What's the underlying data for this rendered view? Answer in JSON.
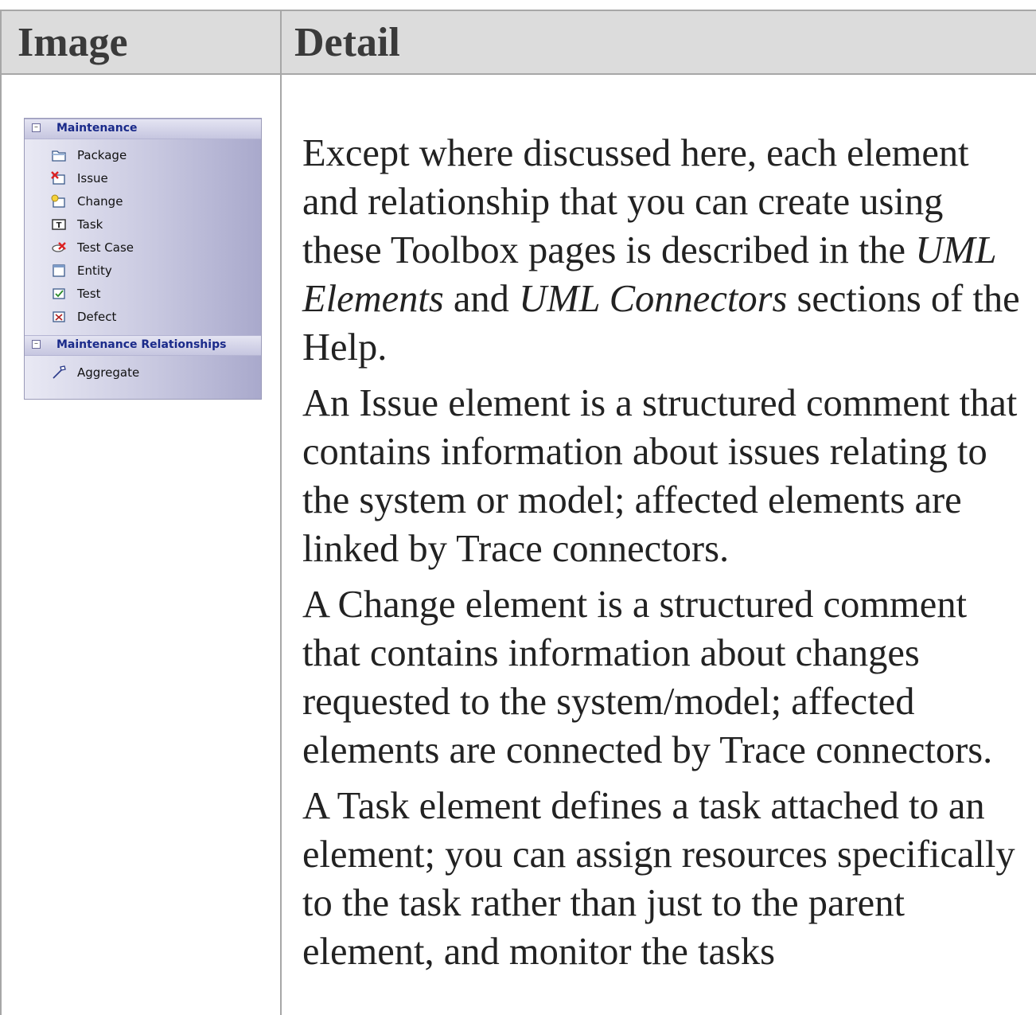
{
  "table": {
    "headers": [
      "Image",
      "Detail"
    ]
  },
  "toolbox": {
    "sections": [
      {
        "title": "Maintenance",
        "items": [
          {
            "label": "Package",
            "icon": "package-icon"
          },
          {
            "label": "Issue",
            "icon": "issue-icon"
          },
          {
            "label": "Change",
            "icon": "change-icon"
          },
          {
            "label": "Task",
            "icon": "task-icon"
          },
          {
            "label": "Test Case",
            "icon": "test-case-icon"
          },
          {
            "label": "Entity",
            "icon": "entity-icon"
          },
          {
            "label": "Test",
            "icon": "test-icon"
          },
          {
            "label": "Defect",
            "icon": "defect-icon"
          }
        ]
      },
      {
        "title": "Maintenance Relationships",
        "items": [
          {
            "label": "Aggregate",
            "icon": "aggregate-icon"
          }
        ]
      }
    ]
  },
  "detail": {
    "p1": {
      "pre": "Except where discussed here, each element and relationship that you can create using these Toolbox pages is described in the ",
      "em1": "UML Elements",
      "mid": " and ",
      "em2": "UML Connectors",
      "post": " sections of the Help."
    },
    "p2": "An Issue element is a structured comment that contains information about issues relating to the system or model; affected elements are linked by Trace connectors.",
    "p3": "A Change element is a structured comment that contains information about changes requested to the system/model; affected elements are connected by Trace connectors.",
    "p4": "A Task element defines a task attached to an element; you can assign resources specifically to the task rather than just to the parent element, and monitor the tasks"
  }
}
